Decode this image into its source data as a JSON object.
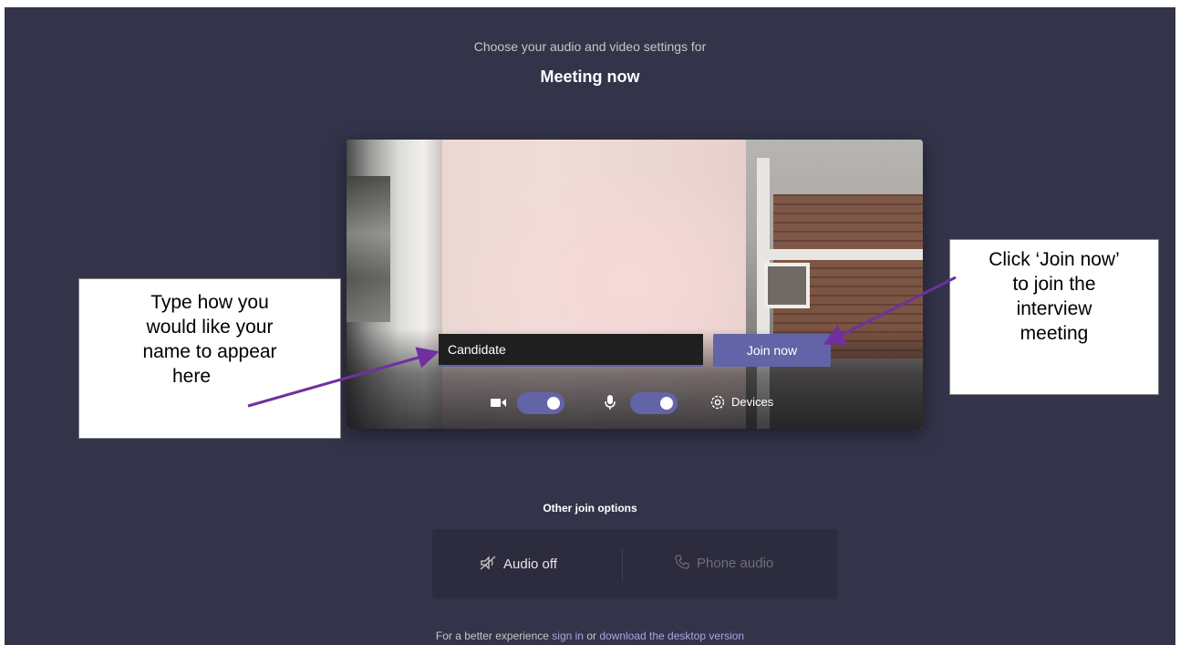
{
  "header": {
    "subtitle": "Choose your audio and video settings for",
    "title": "Meeting now"
  },
  "preview": {
    "name_value": "Candidate",
    "join_label": "Join now",
    "camera_on": true,
    "mic_on": true,
    "devices_label": "Devices"
  },
  "other_options": {
    "heading": "Other join options",
    "audio_off_label": "Audio off",
    "phone_audio_label": "Phone audio"
  },
  "footer": {
    "prefix": "For a better experience ",
    "sign_in_link": "sign in",
    "middle": " or ",
    "download_link": "download the desktop version"
  },
  "annotations": {
    "left_lines": [
      "Type how you",
      "would like your",
      "name to appear",
      "here"
    ],
    "right_lines": [
      "Click ‘Join now’",
      "to join the",
      "interview",
      "meeting"
    ]
  },
  "colors": {
    "background": "#33344a",
    "accent": "#6264a7",
    "arrow": "#7030a0",
    "link": "#a6a7dc"
  }
}
